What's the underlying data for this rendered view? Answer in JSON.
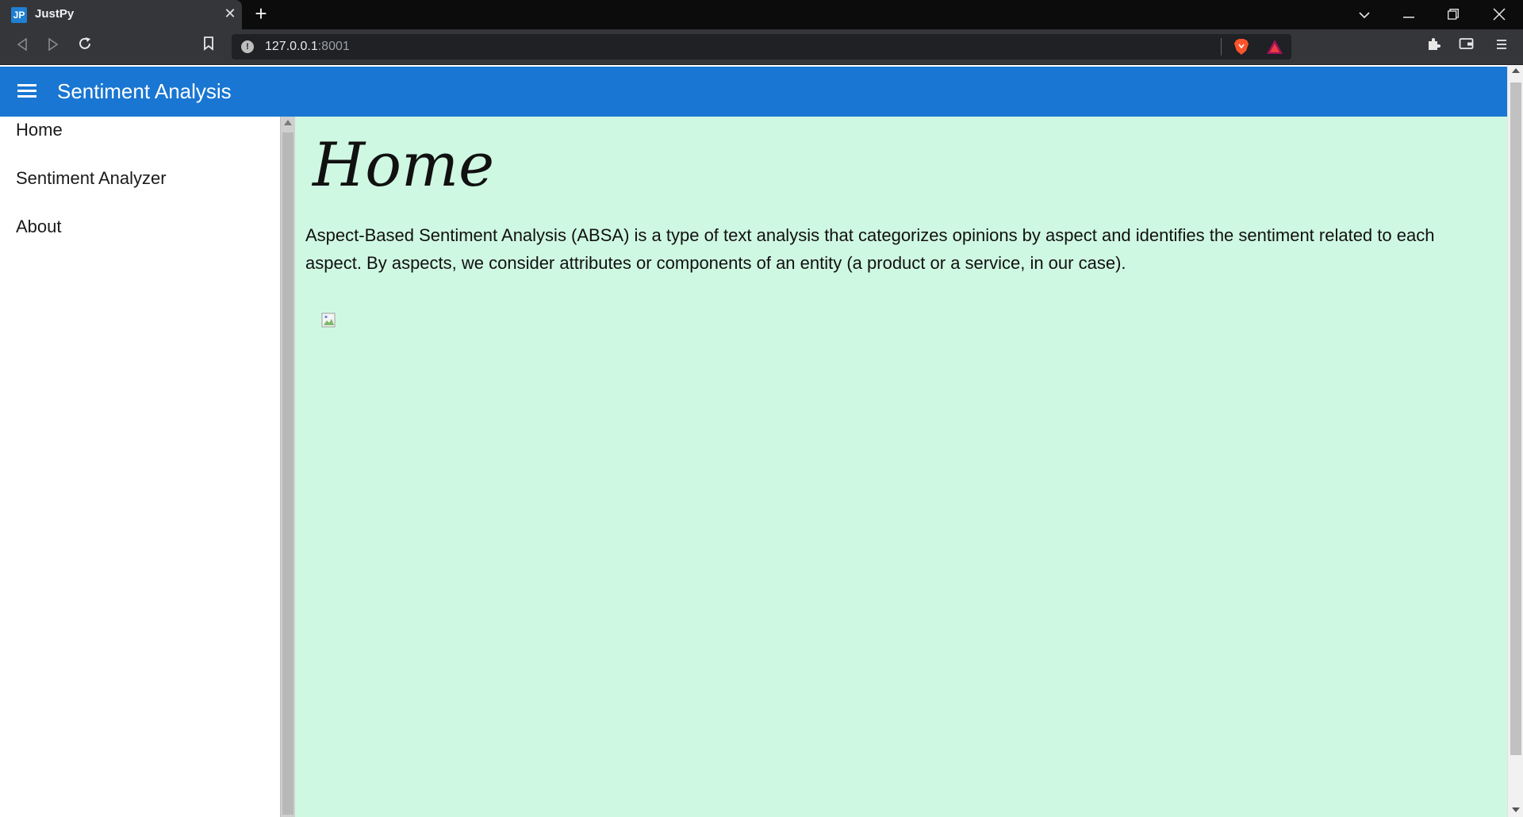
{
  "browser": {
    "tab": {
      "favicon_text": "JP",
      "title": "JustPy"
    },
    "url": {
      "host": "127.0.0.1",
      "port": ":8001"
    },
    "icons": [
      "back-icon",
      "forward-icon",
      "reload-icon",
      "bookmark-icon",
      "site-info-icon",
      "brave-shields-icon",
      "brave-rewards-icon",
      "extensions-icon",
      "wallet-icon",
      "menu-icon",
      "tab-search-icon",
      "minimize-icon",
      "restore-icon",
      "close-icon"
    ]
  },
  "header": {
    "title": "Sentiment Analysis",
    "color": "#1976d2"
  },
  "drawer": {
    "items": [
      {
        "label": "Home"
      },
      {
        "label": "Sentiment Analyzer"
      },
      {
        "label": "About"
      }
    ]
  },
  "main": {
    "heading": "Home",
    "paragraph": "Aspect-Based Sentiment Analysis (ABSA) is a type of text analysis that categorizes opinions by aspect and identifies the sentiment related to each aspect. By aspects, we consider attributes or components of an entity (a product or a service, in our case).",
    "background": "#cff8e2"
  }
}
